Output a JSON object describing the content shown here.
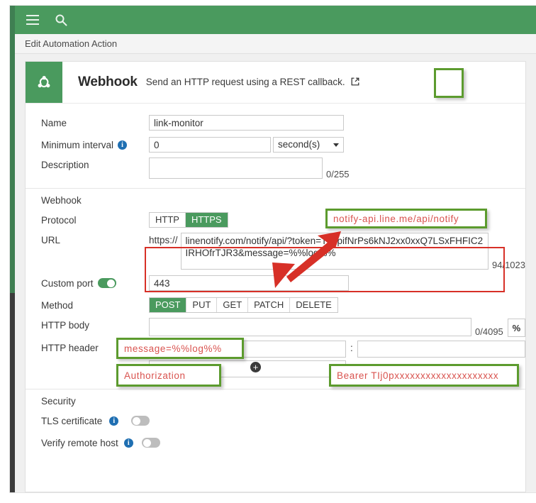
{
  "topbar": {
    "menu_icon": "hamburger-menu-icon",
    "search_icon": "search-icon"
  },
  "breadcrumb": "Edit Automation Action",
  "header": {
    "icon": "webhook-icon",
    "title": "Webhook",
    "subtitle": "Send an HTTP request using a REST callback.",
    "external_link_icon": "external-link-icon"
  },
  "general": {
    "name_label": "Name",
    "name_value": "link-monitor",
    "interval_label": "Minimum interval",
    "interval_value": "0",
    "interval_unit": "second(s)",
    "description_label": "Description",
    "description_value": "",
    "description_counter": "0/255"
  },
  "webhook": {
    "section_title": "Webhook",
    "protocol_label": "Protocol",
    "protocol_options": [
      "HTTP",
      "HTTPS"
    ],
    "protocol_selected": "HTTPS",
    "url_label": "URL",
    "url_prefix": "https://",
    "url_value": "linenotify.com/notify/api/?token=TIj0pifNrPs6kNJ2xx0xxQ7LSxFHFIC2IRHOfrTJR3&message=%%log%%",
    "url_counter": "94/1023",
    "custom_port_label": "Custom port",
    "custom_port_enabled": true,
    "custom_port_value": "443",
    "method_label": "Method",
    "method_options": [
      "POST",
      "PUT",
      "GET",
      "PATCH",
      "DELETE"
    ],
    "method_selected": "POST",
    "http_body_label": "HTTP body",
    "http_body_value": "",
    "http_body_counter": "0/4095",
    "percent_button": "%",
    "http_header_label": "HTTP header",
    "http_header_name": "",
    "http_header_separator": ":",
    "http_header_value": "",
    "add_header_icon": "plus-icon"
  },
  "security": {
    "section_title": "Security",
    "tls_label": "TLS certificate",
    "tls_enabled": false,
    "verify_label": "Verify remote host",
    "verify_enabled": false
  },
  "annotations": {
    "url_host": "notify-api.line.me/api/notify",
    "http_body": "message=%%log%%",
    "header_name": "Authorization",
    "header_value": "Bearer TIj0pxxxxxxxxxxxxxxxxxxxx",
    "empty_box": ""
  },
  "colors": {
    "brand_green": "#4a9a5e",
    "annotation_green": "#5c9b2e",
    "annotation_red": "#d9534f",
    "highlight_red": "#d73027",
    "info_blue": "#1f6fb2"
  }
}
